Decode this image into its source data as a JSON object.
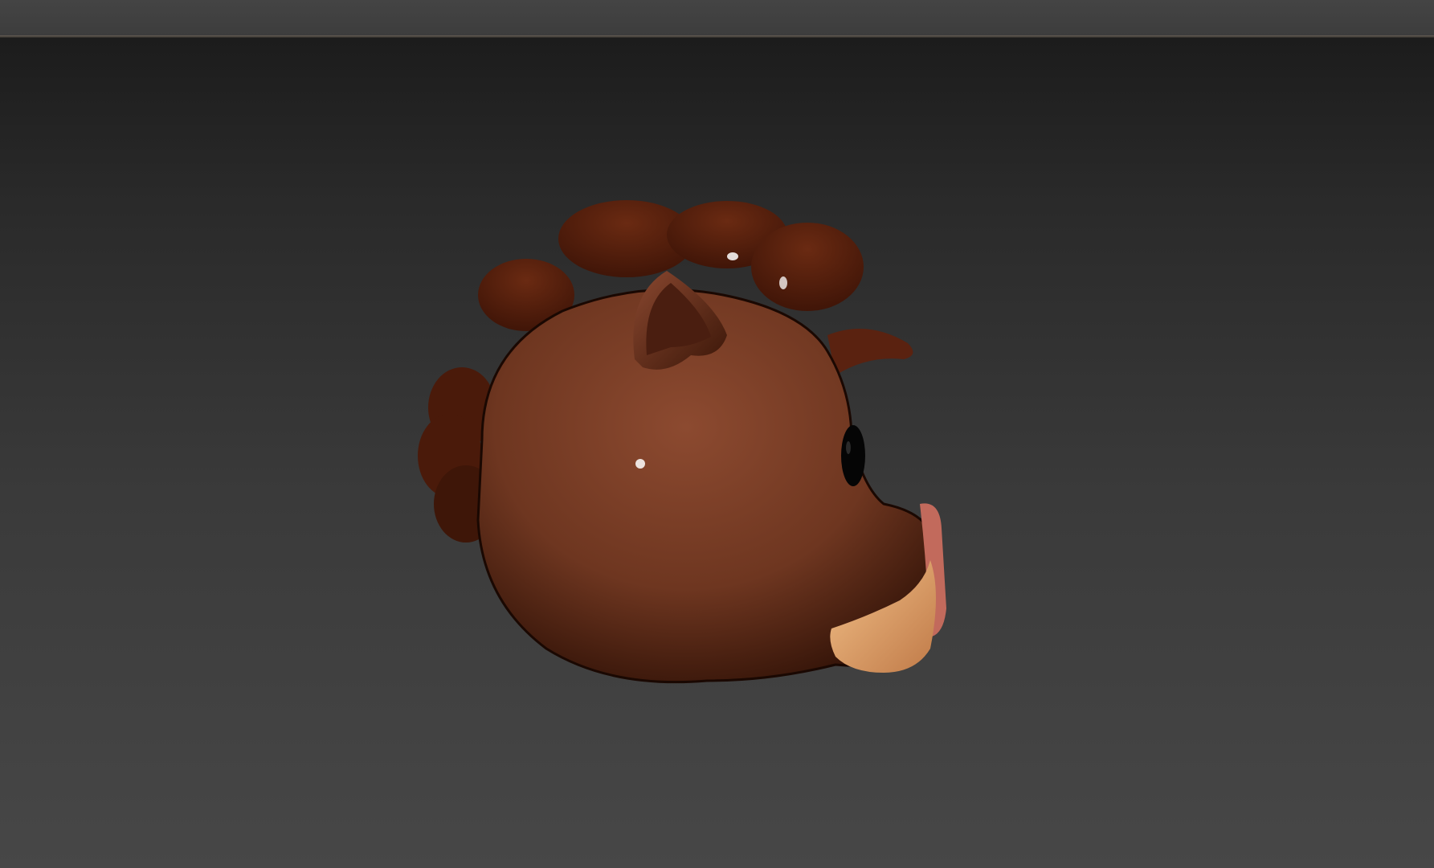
{
  "viewport": {
    "background_top": "#1c1c1c",
    "background_bottom": "#474747"
  },
  "model": {
    "subject": "boar-head",
    "colors": {
      "skin": "#7a3f28",
      "skin_shadow": "#3a1608",
      "mane": "#5a2210",
      "ear_inner": "#6a3020",
      "snout_rim": "#c87062",
      "tusk": "#e8aa70",
      "eye": "#0a0a0a"
    }
  }
}
